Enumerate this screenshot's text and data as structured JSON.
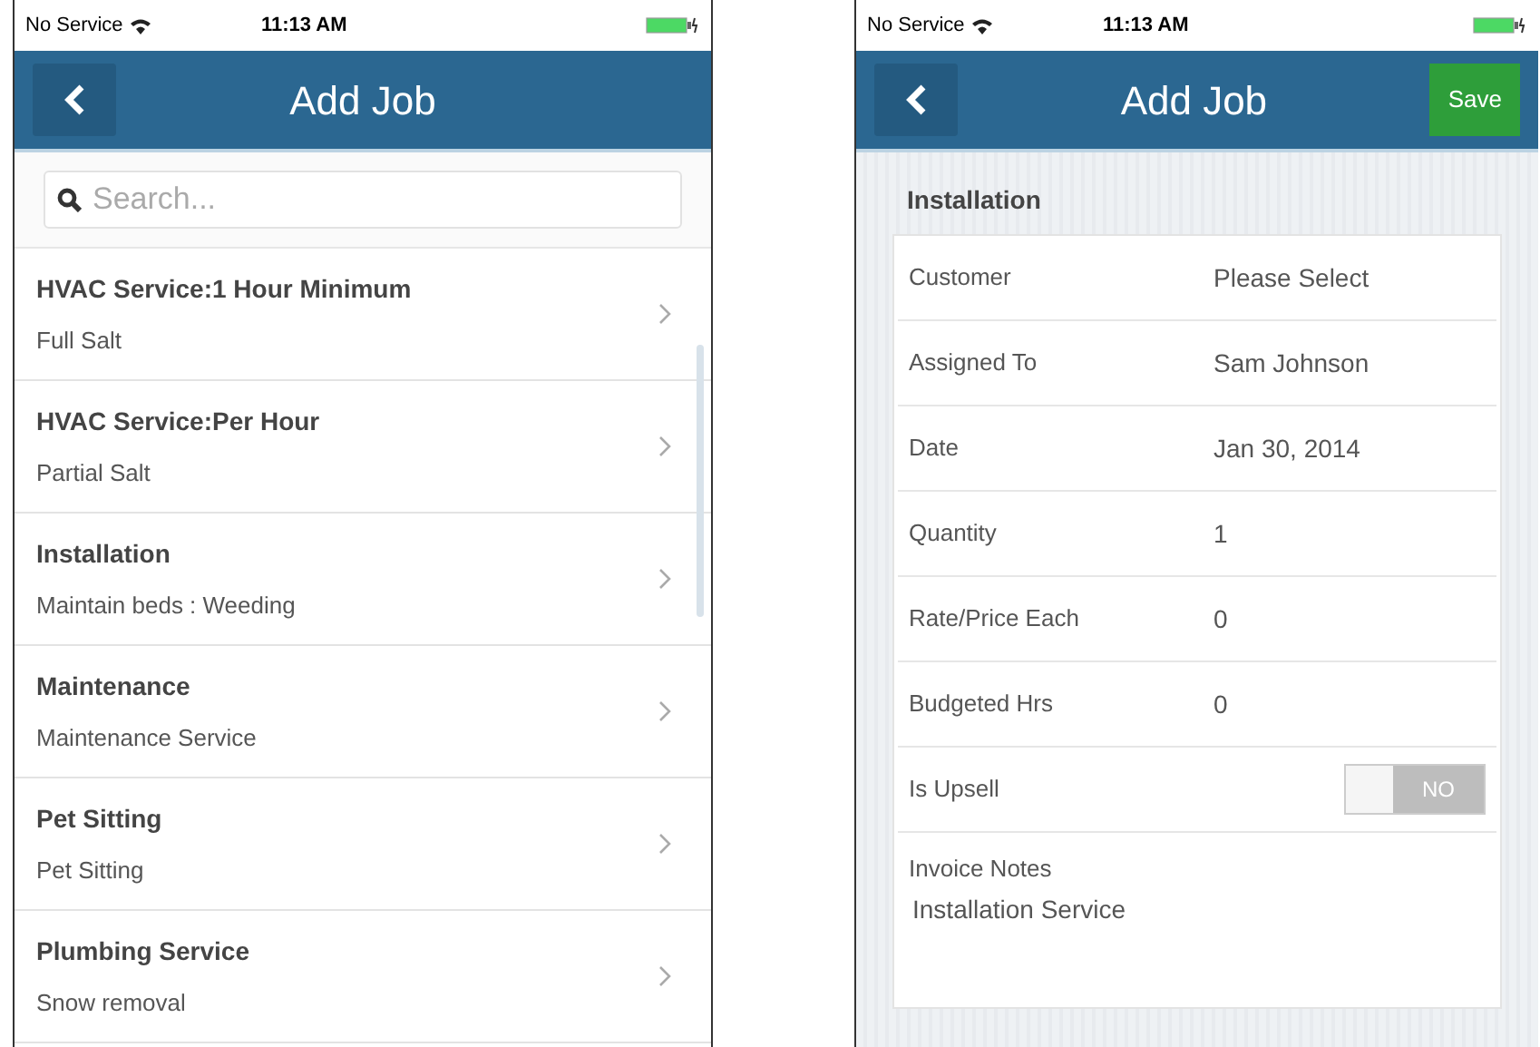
{
  "screens": [
    {
      "status_bar": {
        "carrier": "No Service",
        "time": "11:13 AM"
      },
      "nav": {
        "title": "Add Job"
      },
      "search": {
        "placeholder": "Search..."
      },
      "list": [
        {
          "title": "HVAC Service:1 Hour Minimum",
          "subtitle": "Full Salt"
        },
        {
          "title": "HVAC Service:Per Hour",
          "subtitle": "Partial Salt"
        },
        {
          "title": "Installation",
          "subtitle": "Maintain beds : Weeding"
        },
        {
          "title": "Maintenance",
          "subtitle": "Maintenance Service"
        },
        {
          "title": "Pet Sitting",
          "subtitle": "Pet Sitting"
        },
        {
          "title": "Plumbing Service",
          "subtitle": "Snow removal"
        }
      ]
    },
    {
      "status_bar": {
        "carrier": "No Service",
        "time": "11:13 AM"
      },
      "nav": {
        "title": "Add Job",
        "action": "Save"
      },
      "section": "Installation",
      "fields": [
        {
          "kind": "value",
          "label": "Customer",
          "value": "Please Select"
        },
        {
          "kind": "value",
          "label": "Assigned To",
          "value": "Sam Johnson"
        },
        {
          "kind": "value",
          "label": "Date",
          "value": "Jan 30, 2014"
        },
        {
          "kind": "value",
          "label": "Quantity",
          "value": "1"
        },
        {
          "kind": "value",
          "label": "Rate/Price Each",
          "value": "0"
        },
        {
          "kind": "value",
          "label": "Budgeted Hrs",
          "value": "0"
        },
        {
          "kind": "toggle",
          "label": "Is Upsell",
          "on": false,
          "value": "NO"
        },
        {
          "kind": "notes",
          "label": "Invoice Notes",
          "value": "Installation Service"
        }
      ]
    }
  ]
}
